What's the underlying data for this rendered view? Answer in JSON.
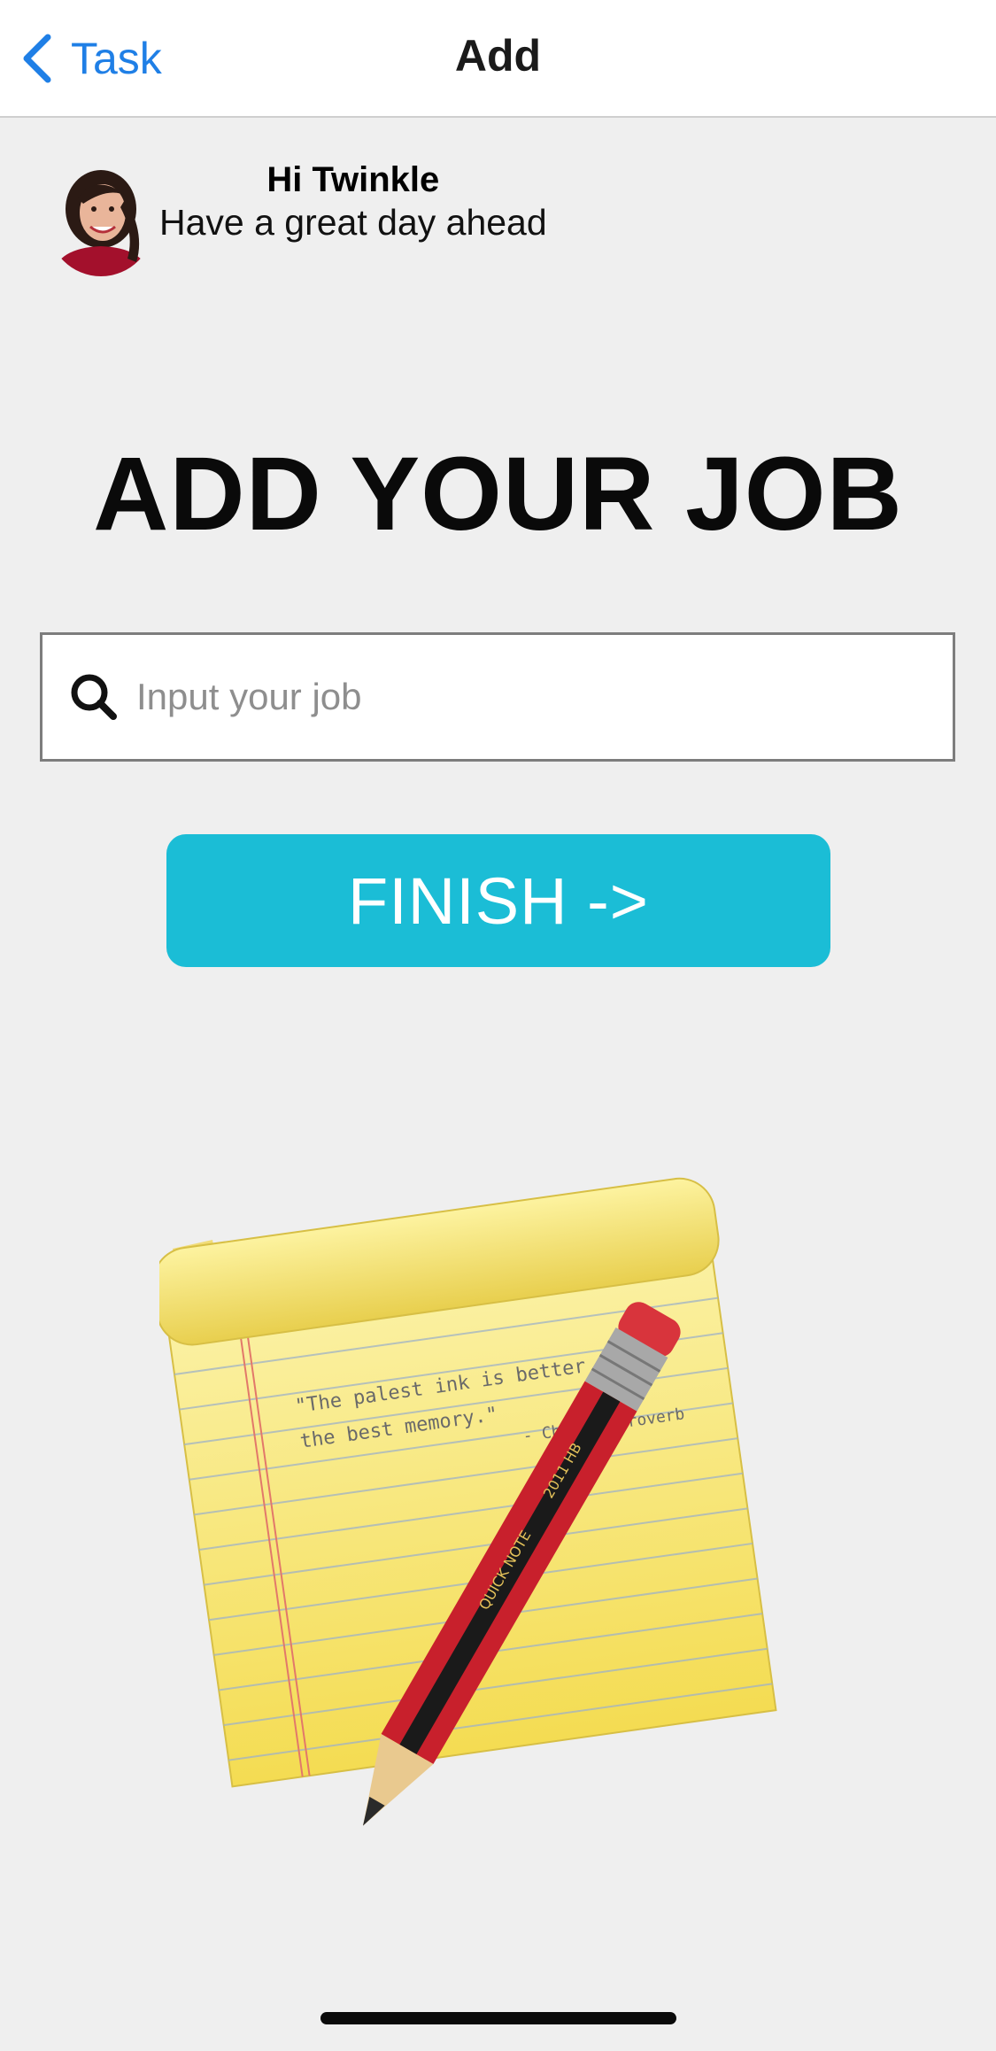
{
  "nav": {
    "back_label": "Task",
    "title": "Add",
    "back_icon": "chevron-left-icon",
    "accent_color": "#1f7fe6"
  },
  "greeting": {
    "name": "Hi Twinkle",
    "subtitle": "Have a great day ahead"
  },
  "headline": "ADD YOUR JOB",
  "search": {
    "placeholder": "Input your job",
    "value": "",
    "icon": "search-icon"
  },
  "finish_button": {
    "label": "FINISH ->",
    "color": "#1bbdd6"
  },
  "illustration": {
    "quote_line1": "\"The palest ink is better than",
    "quote_line2": "the best memory.\"",
    "attribution": "- Chinese Proverb",
    "pencil_text": "QUICK NOTE",
    "pencil_text2": "2011  HB"
  }
}
